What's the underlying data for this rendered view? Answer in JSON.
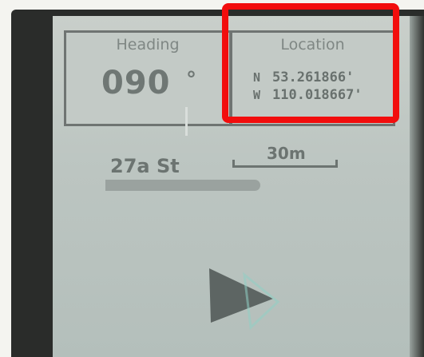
{
  "data_fields": {
    "heading": {
      "label": "Heading",
      "value": "090",
      "unit": "°"
    },
    "location": {
      "label": "Location",
      "latitude": {
        "dir": "N",
        "value": "53.261866'"
      },
      "longitude": {
        "dir": "W",
        "value": "110.018667'"
      }
    }
  },
  "map": {
    "street_label": "27a St",
    "scale_label": "30m"
  },
  "icons": {
    "position_marker": "navigation-arrow-icon"
  },
  "colors": {
    "highlight": "#f20d0d",
    "screen": "#c3cac6"
  }
}
